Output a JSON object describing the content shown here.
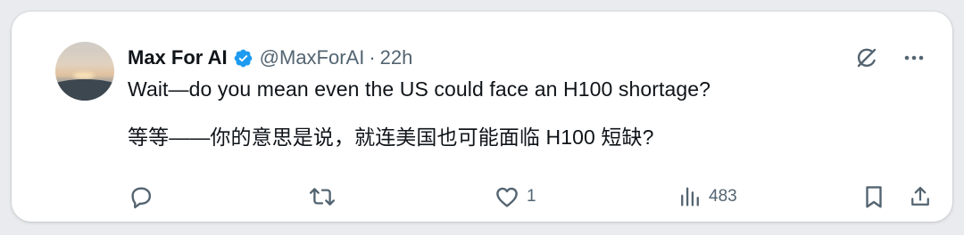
{
  "tweet": {
    "author": {
      "display_name": "Max For AI",
      "handle": "@MaxForAI",
      "verified": true,
      "avatar_icon": "avatar-photo"
    },
    "separator": "·",
    "timestamp": "22h",
    "text_lines": [
      "Wait—do you mean even the US could face an H100 shortage?",
      "等等——你的意思是说，就连美国也可能面临 H100 短缺?"
    ],
    "top_icons": [
      "grok-icon",
      "more-icon"
    ],
    "actions": {
      "reply": {
        "icon": "reply-icon",
        "count": ""
      },
      "retweet": {
        "icon": "retweet-icon",
        "count": ""
      },
      "like": {
        "icon": "heart-icon",
        "count": "1"
      },
      "views": {
        "icon": "views-icon",
        "count": "483"
      },
      "bookmark": {
        "icon": "bookmark-icon"
      },
      "share": {
        "icon": "share-icon"
      }
    }
  },
  "colors": {
    "text_primary": "#0f1419",
    "text_secondary": "#536471",
    "verified_blue": "#1d9bf0",
    "card_bg": "#ffffff",
    "page_bg": "#e9ebee"
  }
}
